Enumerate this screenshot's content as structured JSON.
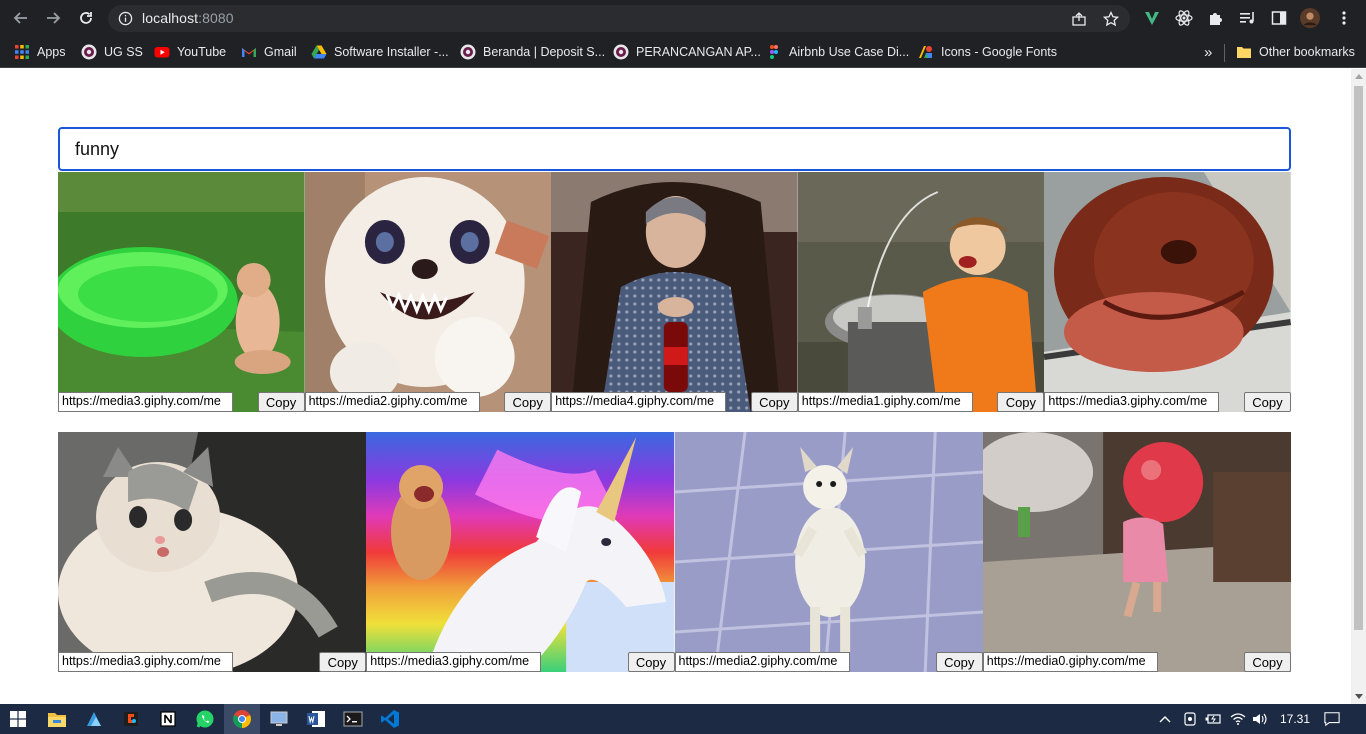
{
  "browser": {
    "url_host": "localhost",
    "url_port": ":8080",
    "bookmarks": [
      {
        "label": "Apps",
        "icon": "apps-grid-icon"
      },
      {
        "label": "UG SS",
        "icon": "ug-logo-icon"
      },
      {
        "label": "YouTube",
        "icon": "youtube-icon"
      },
      {
        "label": "Gmail",
        "icon": "gmail-icon"
      },
      {
        "label": "Software Installer -...",
        "icon": "google-drive-icon"
      },
      {
        "label": "Beranda | Deposit S...",
        "icon": "ug-logo-icon"
      },
      {
        "label": "PERANCANGAN AP...",
        "icon": "ug-logo-icon"
      },
      {
        "label": "Airbnb Use Case Di...",
        "icon": "figma-icon"
      },
      {
        "label": "Icons - Google Fonts",
        "icon": "google-fonts-icon"
      }
    ],
    "more_bookmarks": "»",
    "other_bookmarks": "Other bookmarks"
  },
  "search": {
    "value": "funny"
  },
  "results": {
    "row1": [
      {
        "url": "https://media3.giphy.com/me",
        "copy_label": "Copy",
        "subject": "baby by green kiddie pool"
      },
      {
        "url": "https://media2.giphy.com/me",
        "copy_label": "Copy",
        "subject": "angry white plush toy"
      },
      {
        "url": "https://media4.giphy.com/me",
        "copy_label": "Copy",
        "subject": "woman with coca-cola bottle"
      },
      {
        "url": "https://media1.giphy.com/me",
        "copy_label": "Copy",
        "subject": "boy at drinking fountain"
      },
      {
        "url": "https://media3.giphy.com/me",
        "copy_label": "Copy",
        "subject": "dog head out car window"
      }
    ],
    "row2": [
      {
        "url": "https://media3.giphy.com/me",
        "copy_label": "Copy",
        "subject": "kitten lying down"
      },
      {
        "url": "https://media3.giphy.com/me",
        "copy_label": "Copy",
        "subject": "cat riding rainbow unicorn"
      },
      {
        "url": "https://media2.giphy.com/me",
        "copy_label": "Copy",
        "subject": "chihuahua standing on tiles"
      },
      {
        "url": "https://media0.giphy.com/me",
        "copy_label": "Copy",
        "subject": "child with pink ball"
      }
    ]
  },
  "taskbar": {
    "clock": "17.31"
  },
  "colors": {
    "chrome_bg": "#202124",
    "search_border": "#1a56db",
    "taskbar_bg": "#1c2a44"
  }
}
